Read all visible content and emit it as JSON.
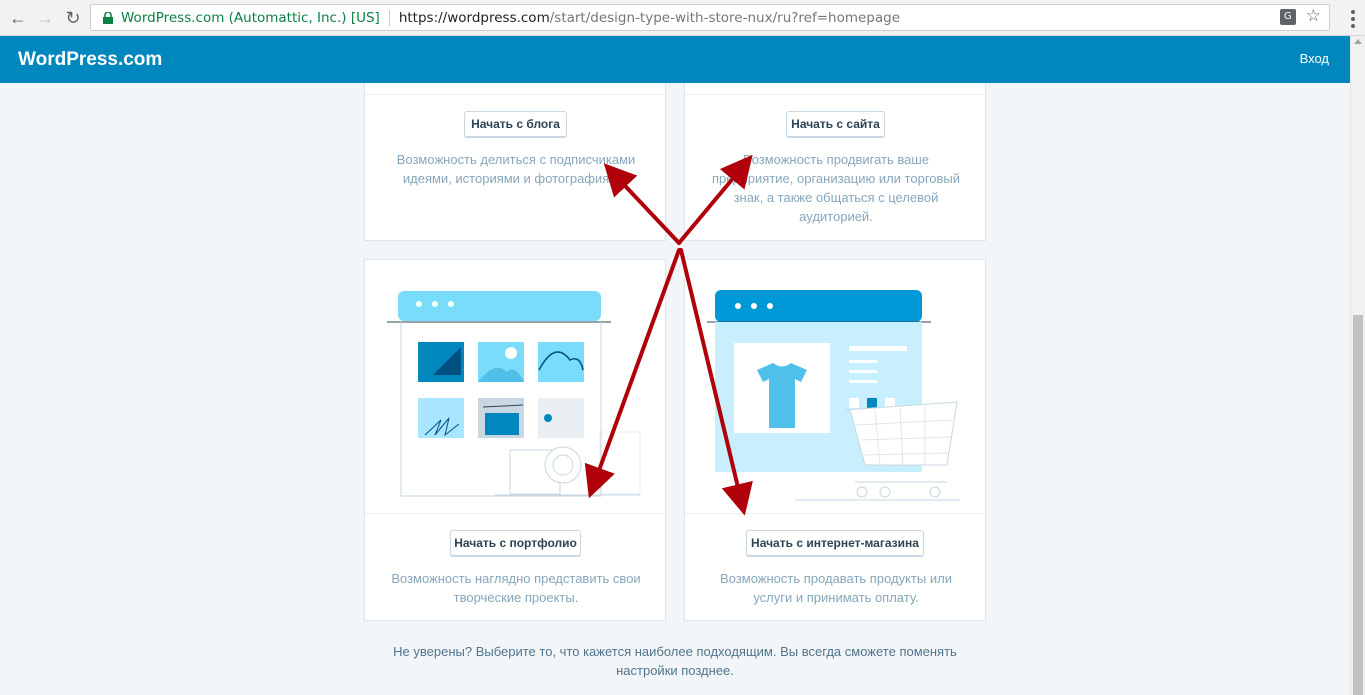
{
  "browser": {
    "org_name": "WordPress.com (Automattic, Inc.) [US]",
    "url_host": "https://wordpress.com",
    "url_path": "/start/design-type-with-store-nux/ru?ref=homepage"
  },
  "masterbar": {
    "logo": "WordPress.com",
    "login": "Вход"
  },
  "cards": {
    "blog": {
      "button": "Начать с блога",
      "description": "Возможность делиться с подписчиками идеями, историями и фотографиями."
    },
    "site": {
      "button": "Начать с сайта",
      "description": "Возможность продвигать ваше предприятие, организацию или торговый знак, а также общаться с целевой аудиторией."
    },
    "portfolio": {
      "button": "Начать с портфолио",
      "description": "Возможность наглядно представить свои творческие проекты."
    },
    "store": {
      "button": "Начать с интернет-магазина",
      "description": "Возможность продавать продукты или услуги и принимать оплату."
    }
  },
  "footer": {
    "note": "Не уверены? Выберите то, что кажется наиболее подходящим. Вы всегда сможете поменять настройки позднее."
  },
  "colors": {
    "masterbar": "#0087be",
    "page_bg": "#f3f6f8",
    "arrow": "#b0000a"
  }
}
